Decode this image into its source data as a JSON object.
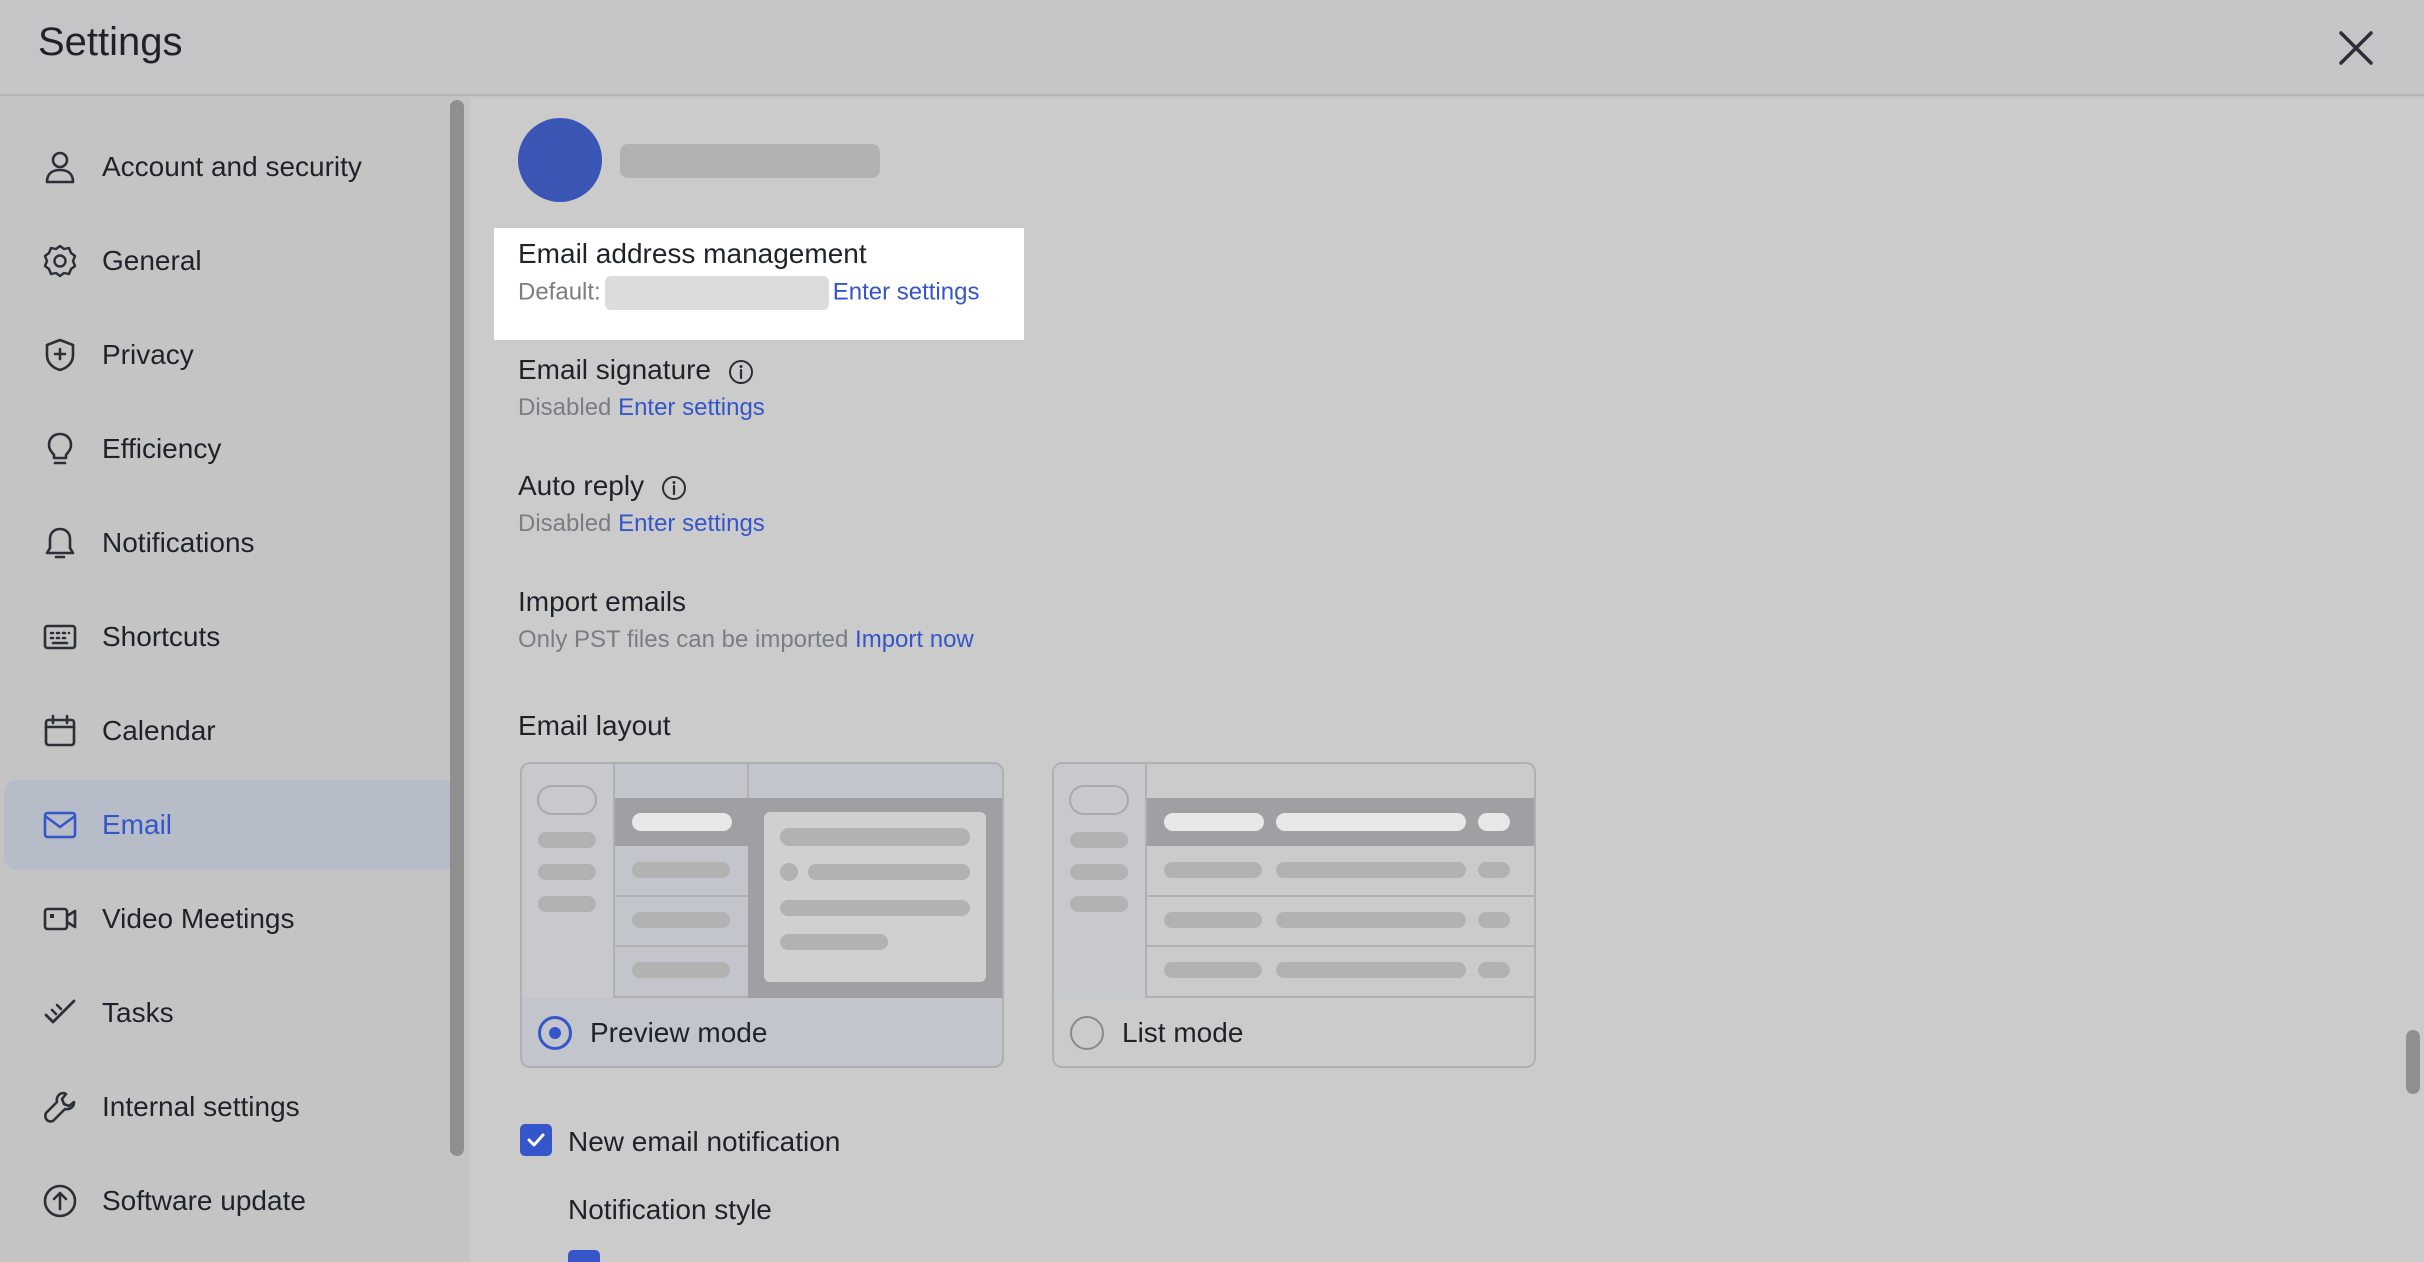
{
  "window": {
    "title": "Settings"
  },
  "sidebar": {
    "items": [
      {
        "label": "Account and security",
        "icon": "user-icon"
      },
      {
        "label": "General",
        "icon": "gear-icon"
      },
      {
        "label": "Privacy",
        "icon": "shield-icon"
      },
      {
        "label": "Efficiency",
        "icon": "lightbulb-icon"
      },
      {
        "label": "Notifications",
        "icon": "bell-icon"
      },
      {
        "label": "Shortcuts",
        "icon": "keyboard-icon"
      },
      {
        "label": "Calendar",
        "icon": "calendar-icon"
      },
      {
        "label": "Email",
        "icon": "mail-icon",
        "active": true
      },
      {
        "label": "Video Meetings",
        "icon": "video-camera-icon"
      },
      {
        "label": "Tasks",
        "icon": "tasks-check-icon"
      },
      {
        "label": "Internal settings",
        "icon": "wrench-icon"
      },
      {
        "label": "Software update",
        "icon": "upload-arrow-icon"
      }
    ]
  },
  "email": {
    "address_management": {
      "title": "Email address management",
      "default_prefix": "Default:",
      "link": "Enter settings"
    },
    "signature": {
      "title": "Email signature",
      "status": "Disabled",
      "link": "Enter settings"
    },
    "auto_reply": {
      "title": "Auto reply",
      "status": "Disabled",
      "link": "Enter settings"
    },
    "import": {
      "title": "Import emails",
      "note": "Only PST files can be imported",
      "link": "Import now"
    },
    "layout": {
      "title": "Email layout",
      "options": [
        {
          "label": "Preview mode",
          "selected": true
        },
        {
          "label": "List mode",
          "selected": false
        }
      ]
    },
    "new_email_notification": {
      "label": "New email notification",
      "checked": true
    },
    "notification_style": {
      "title": "Notification style"
    }
  },
  "colors": {
    "accent": "#3556c9",
    "active_nav_bg": "#b7bdc8",
    "highlight": "#ffffff"
  }
}
